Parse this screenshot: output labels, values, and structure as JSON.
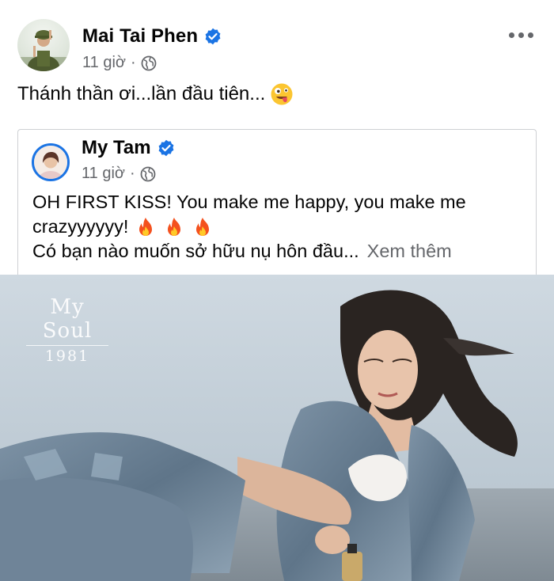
{
  "post": {
    "author": "Mai Tai Phen",
    "time": "11 giờ",
    "separator": "·",
    "text": "Thánh thần ơi...lần đầu tiên...",
    "emoji_icon": "zany-face-emoji"
  },
  "shared_post": {
    "author": "My Tam",
    "time": "11 giờ",
    "separator": "·",
    "line1": "OH FIRST KISS! You make me happy, you make me",
    "line2": "crazyyyyyy!",
    "line3": "Có bạn nào muốn sở hữu nụ hôn đầu...",
    "see_more": "Xem thêm",
    "fire_icons": [
      "fire-emoji",
      "fire-emoji",
      "fire-emoji"
    ]
  },
  "photo": {
    "watermark_title": "My Soul",
    "watermark_year": "1981"
  },
  "colors": {
    "verified_blue": "#1b74e4",
    "secondary_text": "#65676b",
    "card_border": "#ced0d4"
  }
}
